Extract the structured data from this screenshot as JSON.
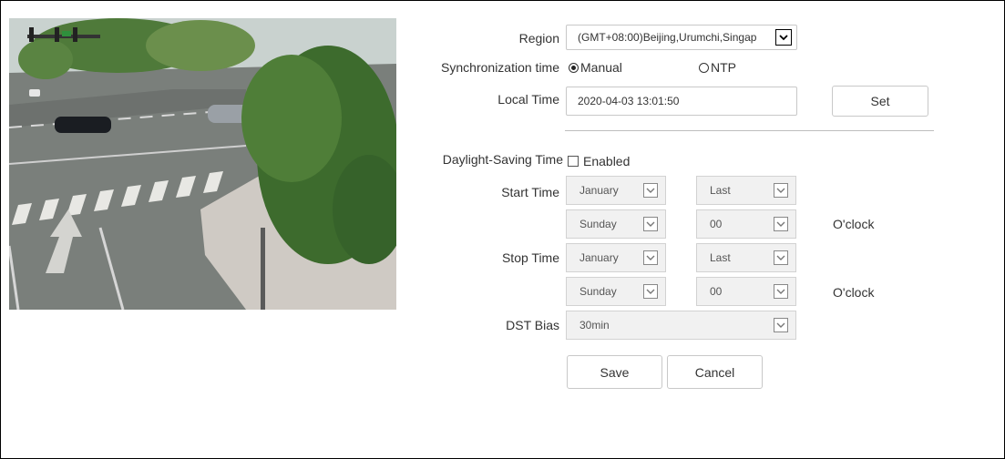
{
  "camera": {
    "alt": ""
  },
  "region": {
    "label": "Region",
    "value": "(GMT+08:00)Beijing,Urumchi,Singap"
  },
  "sync": {
    "label": "Synchronization time",
    "manual_label": "Manual",
    "ntp_label": "NTP",
    "selected": "manual"
  },
  "local_time": {
    "label": "Local Time",
    "value": "2020-04-03 13:01:50",
    "set_label": "Set"
  },
  "dst": {
    "label": "Daylight-Saving Time",
    "enabled_label": "Enabled",
    "enabled": false,
    "start_label": "Start Time",
    "stop_label": "Stop Time",
    "start": {
      "month": "January",
      "week": "Last",
      "day": "Sunday",
      "hour": "00"
    },
    "stop": {
      "month": "January",
      "week": "Last",
      "day": "Sunday",
      "hour": "00"
    },
    "oclock_label": "O'clock",
    "bias_label": "DST Bias",
    "bias": "30min"
  },
  "actions": {
    "save_label": "Save",
    "cancel_label": "Cancel"
  }
}
